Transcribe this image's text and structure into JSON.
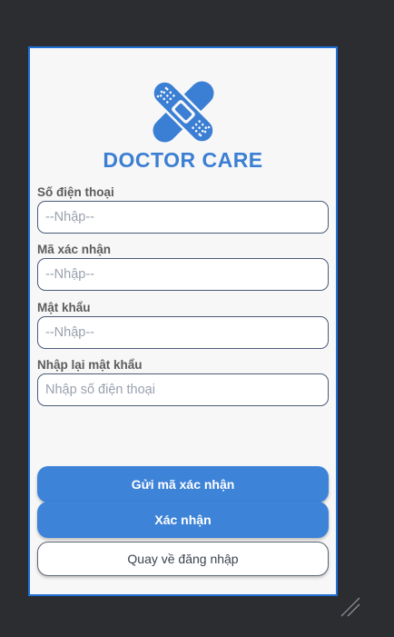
{
  "app": {
    "logo_text": "DOCTOR CARE",
    "brand_color": "#3b7fd4",
    "logo_icon": "crossed-bandages-icon"
  },
  "form": {
    "phone": {
      "label": "Số điện thoại",
      "placeholder": "--Nhập--",
      "value": ""
    },
    "code": {
      "label": "Mã xác nhận",
      "placeholder": "--Nhập--",
      "value": ""
    },
    "password": {
      "label": "Mật khẩu",
      "placeholder": "--Nhập--",
      "value": ""
    },
    "confirm_password": {
      "label": "Nhập lại mật khẩu",
      "placeholder": "Nhập số điện thoại",
      "value": ""
    }
  },
  "buttons": {
    "send_code": "Gửi mã xác nhận",
    "confirm": "Xác nhận",
    "back_to_login": "Quay về đăng nhập"
  },
  "colors": {
    "primary_button": "#3d83d8",
    "window_frame": "#1e6fd6",
    "background": "#2b2d30"
  }
}
